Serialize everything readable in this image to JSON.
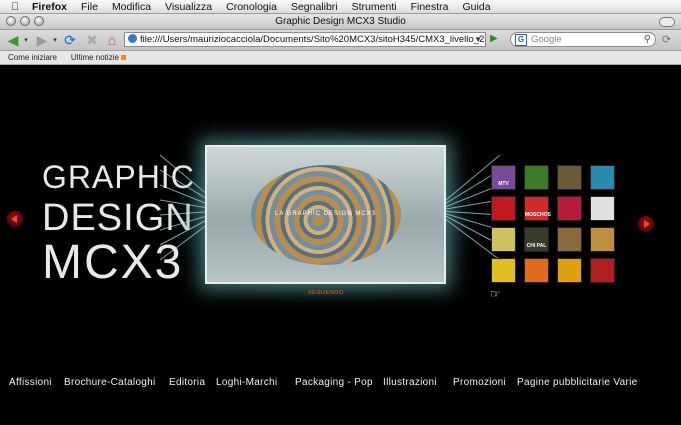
{
  "menubar": {
    "app": "Firefox",
    "items": [
      "File",
      "Modifica",
      "Visualizza",
      "Cronologia",
      "Segnalibri",
      "Strumenti",
      "Finestra",
      "Guida"
    ]
  },
  "window": {
    "title": "Graphic Design MCX3 Studio"
  },
  "toolbar": {
    "url": "file:///Users/mauriziocacciola/Documents/Sito%20MCX3/sitoH345/CMX3_livello_2.html",
    "search_placeholder": "Google",
    "icons": [
      "back-icon",
      "forward-icon",
      "reload-icon",
      "stop-icon",
      "home-icon",
      "go-icon",
      "search-icon"
    ]
  },
  "bookmarks": {
    "items": [
      "Come iniziare",
      "Ultime notizie"
    ]
  },
  "page": {
    "headline": [
      "GRAPHIC",
      "DESIGN",
      "MCX3"
    ],
    "screen_caption": "LA GRAPHIC DESIGN MCX3",
    "sub_button": "SEGUENDO",
    "thumbnails": [
      {
        "label": "MTV",
        "color": "#7a4a9a"
      },
      {
        "label": "",
        "color": "#3a7a2a"
      },
      {
        "label": "",
        "color": "#6a5a3a"
      },
      {
        "label": "",
        "color": "#2a8ab0"
      },
      {
        "label": "",
        "color": "#c01a20"
      },
      {
        "label": "MOSCHOS",
        "color": "#d02a2a"
      },
      {
        "label": "",
        "color": "#b81a3a"
      },
      {
        "label": "",
        "color": "#e0e0e0"
      },
      {
        "label": "",
        "color": "#d0c060"
      },
      {
        "label": "CHI PAL",
        "color": "#3a3a2a"
      },
      {
        "label": "",
        "color": "#8a6a3a"
      },
      {
        "label": "",
        "color": "#c09040"
      },
      {
        "label": "",
        "color": "#e0c020"
      },
      {
        "label": "",
        "color": "#e06a20"
      },
      {
        "label": "",
        "color": "#e0a010"
      },
      {
        "label": "",
        "color": "#b02020"
      }
    ]
  },
  "nav": [
    "Affissioni",
    "Brochure-Cataloghi",
    "Editoria",
    "Loghi-Marchi",
    "Packaging - Pop",
    "Illustrazioni",
    "Promozioni",
    "Pagine pubblicitarie Varie"
  ]
}
